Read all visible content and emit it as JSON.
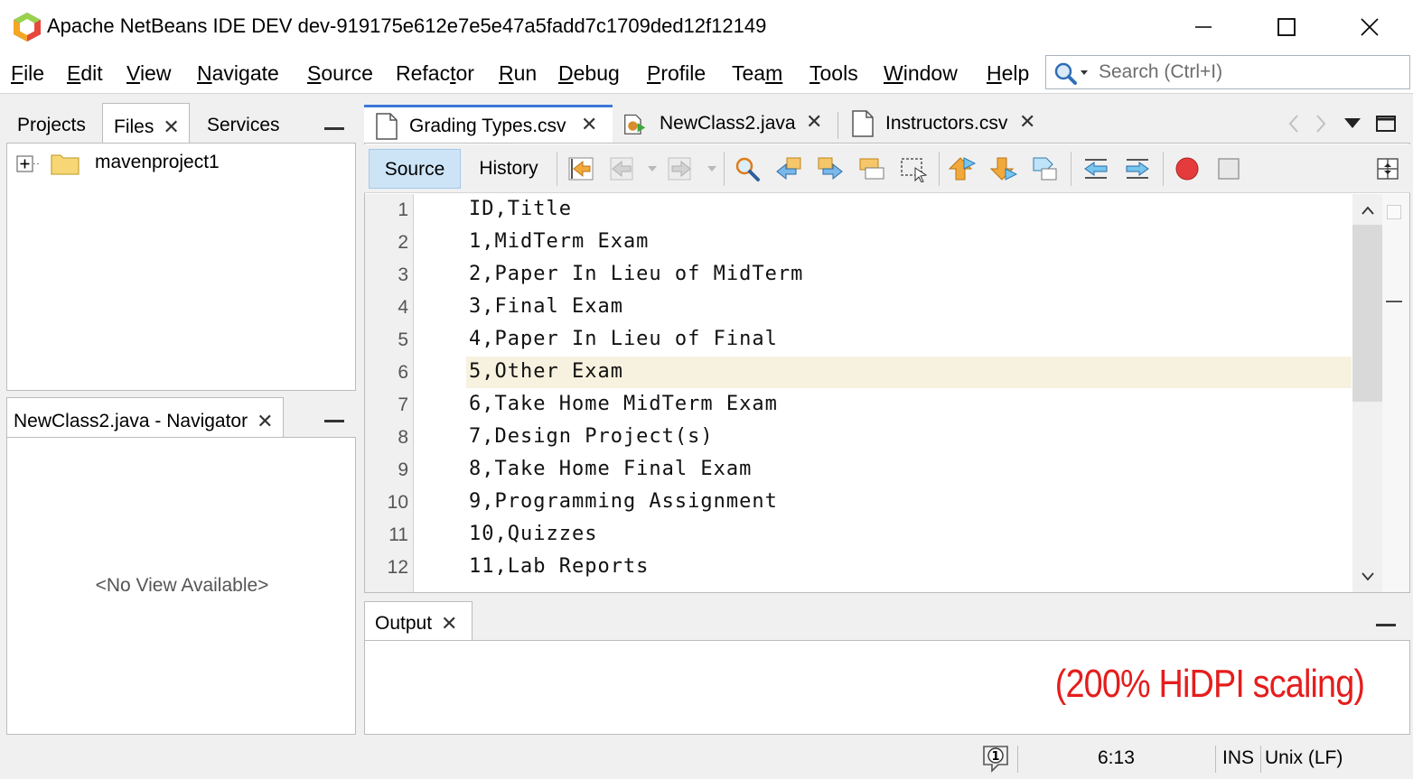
{
  "window": {
    "title": "Apache NetBeans IDE DEV dev-919175e612e7e5e47a5fadd7c1709ded12f12149"
  },
  "menu": [
    {
      "mn": "F",
      "rest": "ile"
    },
    {
      "mn": "E",
      "rest": "dit"
    },
    {
      "mn": "V",
      "rest": "iew"
    },
    {
      "mn": "N",
      "rest": "avigate"
    },
    {
      "mn": "S",
      "rest": "ource"
    },
    {
      "mn": "",
      "pre": "Refac",
      "mn2": "t",
      "rest": "or"
    },
    {
      "mn": "R",
      "rest": "un"
    },
    {
      "mn": "D",
      "rest": "ebug"
    },
    {
      "mn": "P",
      "rest": "rofile"
    },
    {
      "mn": "",
      "pre": "Tea",
      "mn2": "m",
      "rest": ""
    },
    {
      "mn": "T",
      "rest": "ools"
    },
    {
      "mn": "W",
      "rest": "indow"
    },
    {
      "mn": "H",
      "rest": "elp"
    }
  ],
  "search": {
    "placeholder": "Search (Ctrl+I)"
  },
  "top_panel": {
    "tabs": [
      "Projects",
      "Files",
      "Services"
    ],
    "active": "Files",
    "tree": [
      {
        "label": "mavenproject1"
      }
    ]
  },
  "navigator": {
    "tab": "NewClass2.java - Navigator",
    "empty_text": "<No View Available>"
  },
  "editor": {
    "tabs": [
      {
        "label": "Grading Types.csv",
        "icon": "csv-file-icon",
        "active": true
      },
      {
        "label": "NewClass2.java",
        "icon": "java-file-icon",
        "active": false
      },
      {
        "label": "Instructors.csv",
        "icon": "csv-file-icon",
        "active": false
      }
    ],
    "view_buttons": {
      "source": "Source",
      "history": "History"
    },
    "current_line": 6,
    "lines": [
      {
        "n": "1",
        "text": "ID,Title"
      },
      {
        "n": "2",
        "text": "1,MidTerm Exam"
      },
      {
        "n": "3",
        "text": "2,Paper In Lieu of MidTerm"
      },
      {
        "n": "4",
        "text": "3,Final Exam"
      },
      {
        "n": "5",
        "text": "4,Paper In Lieu of Final"
      },
      {
        "n": "6",
        "text": "5,Other Exam"
      },
      {
        "n": "7",
        "text": "6,Take Home MidTerm Exam"
      },
      {
        "n": "8",
        "text": "7,Design Project(s)"
      },
      {
        "n": "9",
        "text": "8,Take Home Final Exam"
      },
      {
        "n": "10",
        "text": "9,Programming Assignment"
      },
      {
        "n": "11",
        "text": "10,Quizzes"
      },
      {
        "n": "12",
        "text": "11,Lab Reports"
      }
    ]
  },
  "output": {
    "tab": "Output",
    "annotation": "(200% HiDPI scaling)"
  },
  "status": {
    "position": "6:13",
    "mode": "INS",
    "line_endings": "Unix (LF)",
    "notifications": "1"
  },
  "colors": {
    "accent": "#3c78d8",
    "current_line": "#f7f1df",
    "annotation": "#e51d1d"
  }
}
